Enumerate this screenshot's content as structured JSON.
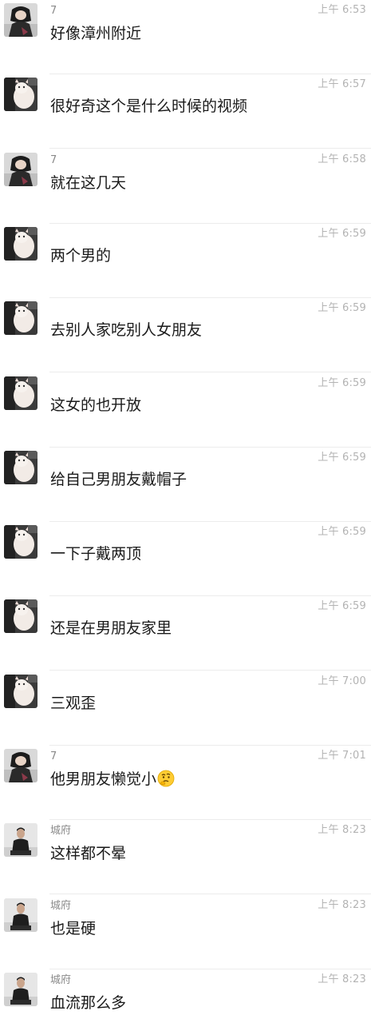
{
  "messages": [
    {
      "sender": "7",
      "time": "上午 6:53",
      "text": "好像漳州附近",
      "avatar": "avatar-a"
    },
    {
      "sender": "",
      "time": "上午 6:57",
      "text": "很好奇这个是什么时候的视频",
      "avatar": "avatar-b"
    },
    {
      "sender": "7",
      "time": "上午 6:58",
      "text": "就在这几天",
      "avatar": "avatar-a"
    },
    {
      "sender": "",
      "time": "上午 6:59",
      "text": "两个男的",
      "avatar": "avatar-b"
    },
    {
      "sender": "",
      "time": "上午 6:59",
      "text": "去别人家吃别人女朋友",
      "avatar": "avatar-b"
    },
    {
      "sender": "",
      "time": "上午 6:59",
      "text": "这女的也开放",
      "avatar": "avatar-b"
    },
    {
      "sender": "",
      "time": "上午 6:59",
      "text": "给自己男朋友戴帽子",
      "avatar": "avatar-b"
    },
    {
      "sender": "",
      "time": "上午 6:59",
      "text": "一下子戴两顶",
      "avatar": "avatar-b"
    },
    {
      "sender": "",
      "time": "上午 6:59",
      "text": "还是在男朋友家里",
      "avatar": "avatar-b"
    },
    {
      "sender": "",
      "time": "上午 7:00",
      "text": "三观歪",
      "avatar": "avatar-b"
    },
    {
      "sender": "7",
      "time": "上午 7:01",
      "text": "他男朋友懒觉小",
      "avatar": "avatar-a",
      "emoji": "thinking-face-icon"
    },
    {
      "sender": "城府",
      "time": "上午 8:23",
      "text": "这样都不晕",
      "avatar": "avatar-c"
    },
    {
      "sender": "城府",
      "time": "上午 8:23",
      "text": "也是硬",
      "avatar": "avatar-c"
    },
    {
      "sender": "城府",
      "time": "上午 8:23",
      "text": "血流那么多",
      "avatar": "avatar-c"
    }
  ]
}
